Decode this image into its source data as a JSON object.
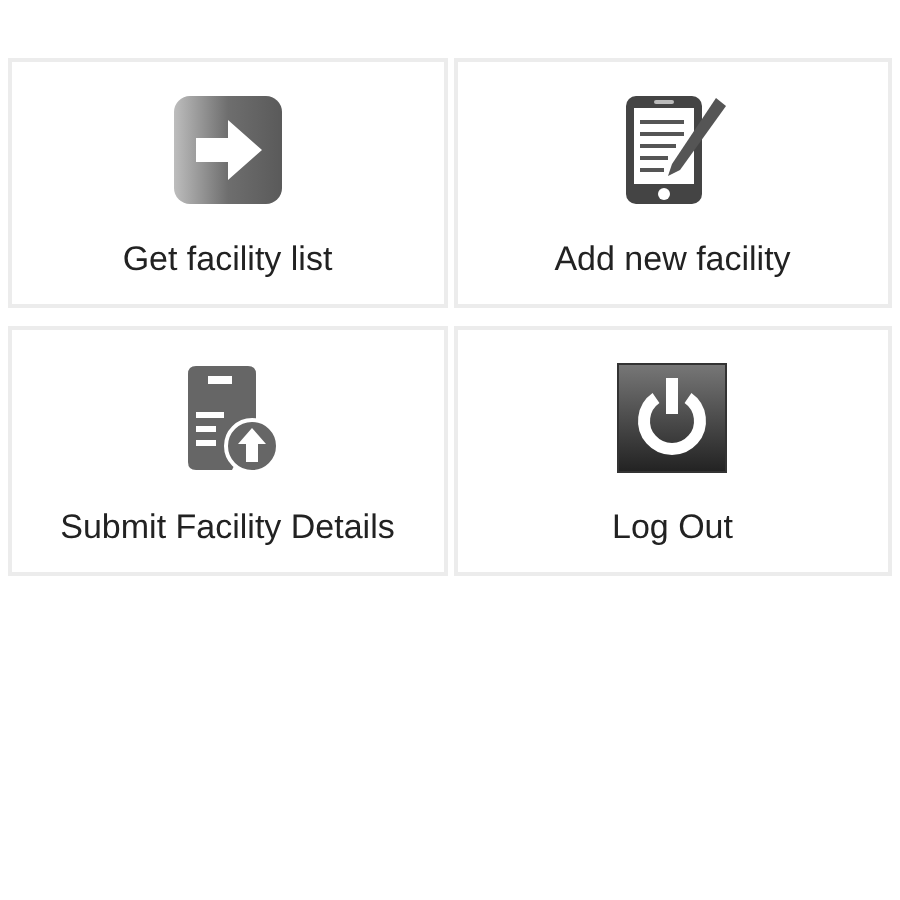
{
  "tiles": [
    {
      "label": "Get facility list",
      "kind": "arrow"
    },
    {
      "label": "Add new facility",
      "kind": "tablet"
    },
    {
      "label": "Submit Facility Details",
      "kind": "upload"
    },
    {
      "label": "Log Out",
      "kind": "power"
    }
  ]
}
